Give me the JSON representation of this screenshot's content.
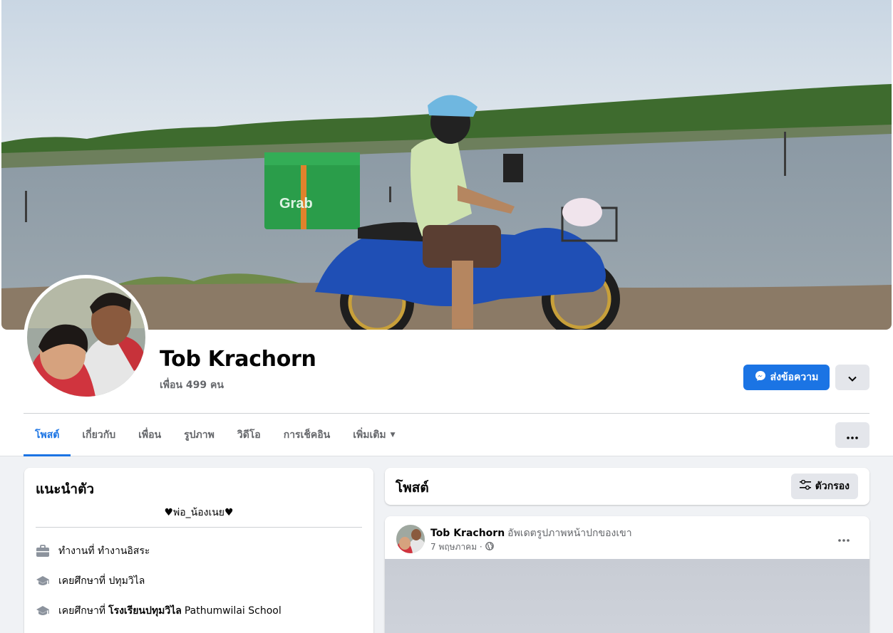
{
  "profile": {
    "name": "Tob Krachorn",
    "friends": "เพื่อน 499 คน",
    "message_button": "ส่งข้อความ"
  },
  "cover": {
    "bag_logo": "Grab"
  },
  "tabs": [
    {
      "label": "โพสต์",
      "active": true
    },
    {
      "label": "เกี่ยวกับ"
    },
    {
      "label": "เพื่อน"
    },
    {
      "label": "รูปภาพ"
    },
    {
      "label": "วิดีโอ"
    },
    {
      "label": "การเช็คอิน"
    },
    {
      "label": "เพิ่มเติม"
    }
  ],
  "intro": {
    "title": "แนะนำตัว",
    "bio": "♥พ่อ_น้องเนย♥",
    "items": [
      {
        "icon": "briefcase-icon",
        "prefix": "ทำงานที่ ทำงานอิสระ",
        "bold": "",
        "suffix": ""
      },
      {
        "icon": "graduation-cap-icon",
        "prefix": "เคยศึกษาที่ ปทุมวิไล",
        "bold": "",
        "suffix": ""
      },
      {
        "icon": "graduation-cap-icon",
        "prefix": "เคยศึกษาที่",
        "bold": "โรงเรียนปทุมวิไล",
        "suffix": "Pathumwilai School"
      }
    ]
  },
  "posts": {
    "title": "โพสต์",
    "filter_button": "ตัวกรอง"
  },
  "post": {
    "author": "Tob Krachorn",
    "action": "อัพเดตรูปภาพหน้าปกของเขา",
    "date": "7 พฤษภาคม ·",
    "privacy_icon": "globe-icon"
  },
  "colors": {
    "accent": "#1b74e4",
    "background": "#f0f2f5",
    "secondary_text": "#65676b",
    "grab_green": "#2a9d4a"
  }
}
